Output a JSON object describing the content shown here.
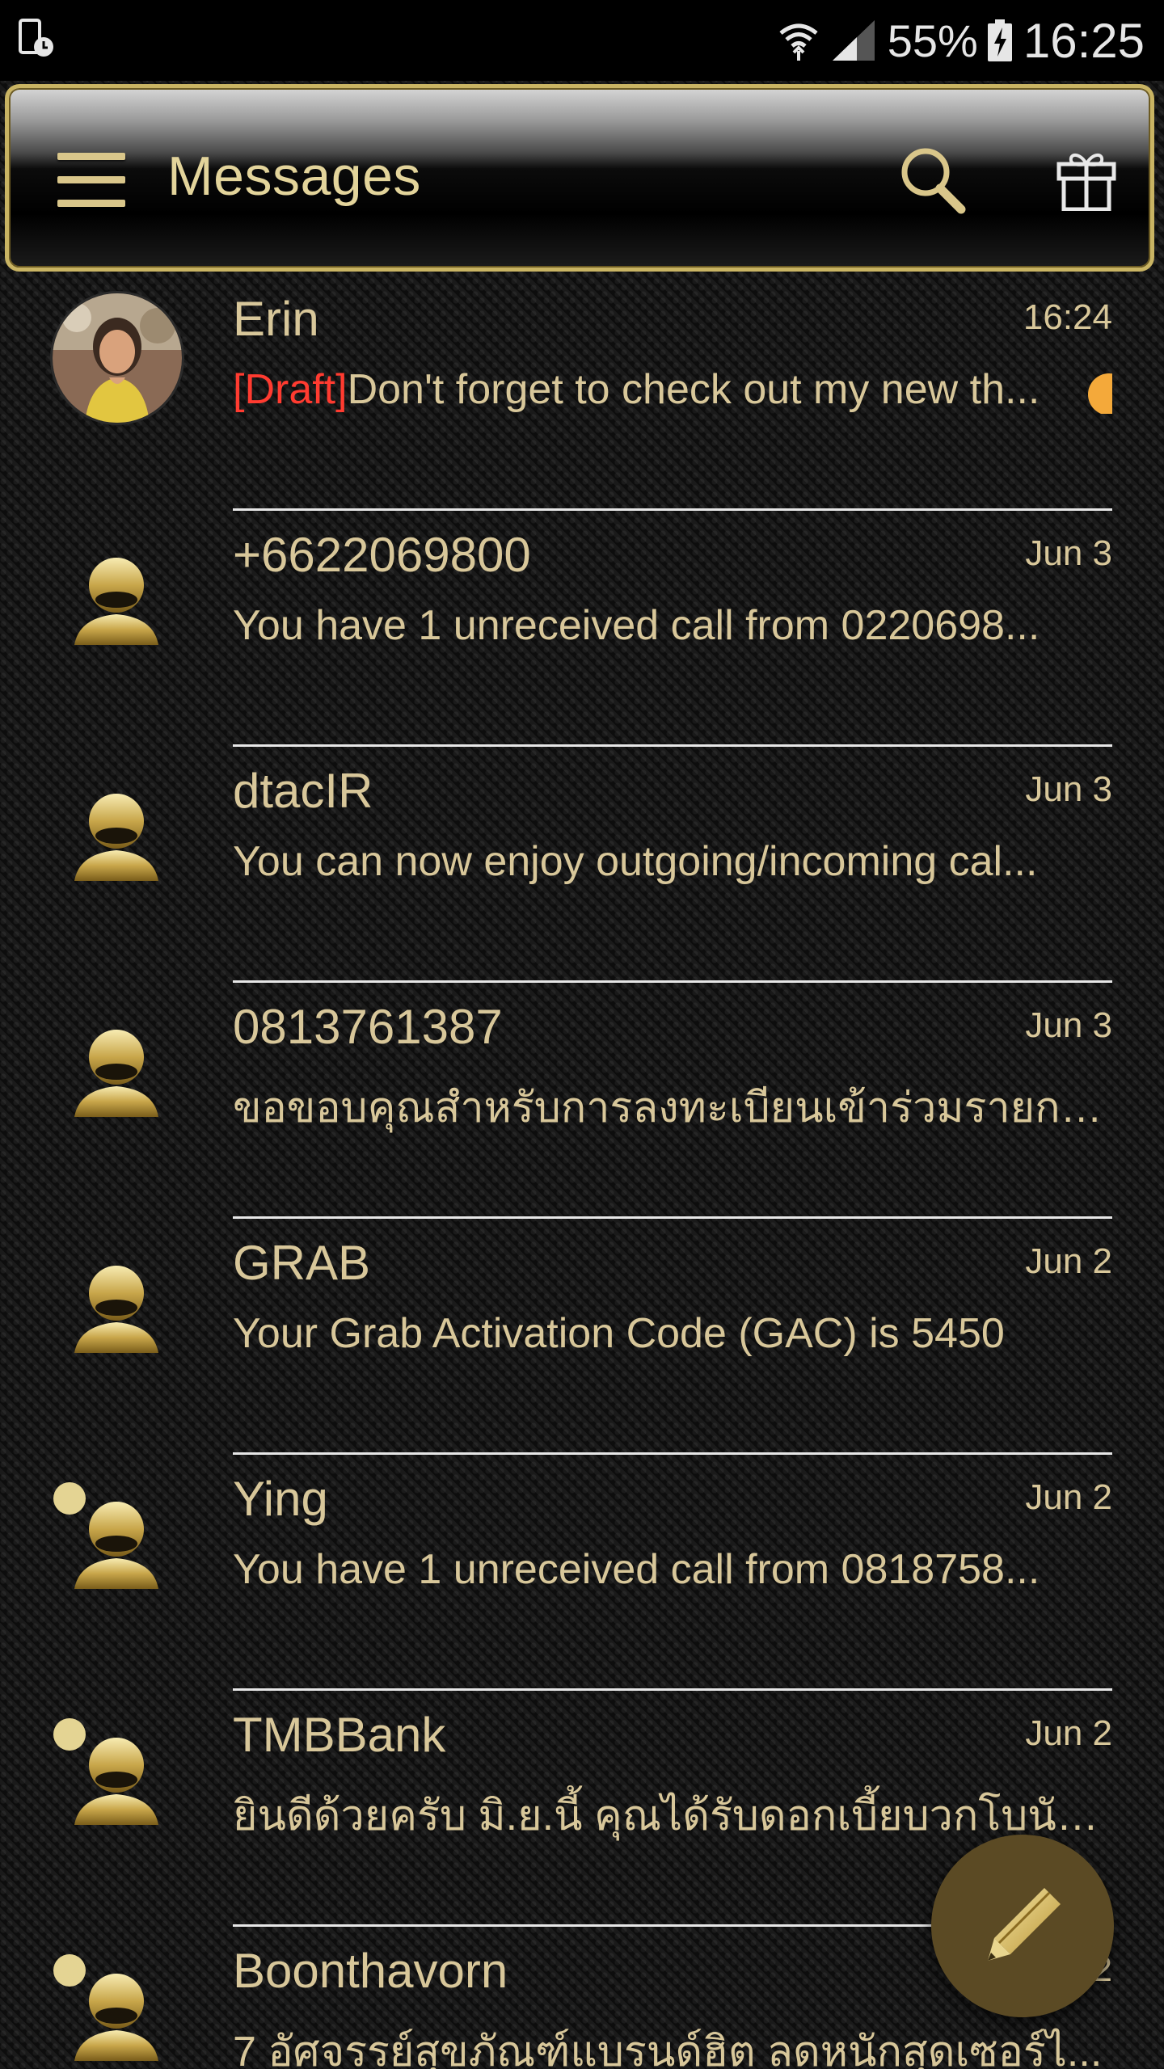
{
  "status_bar": {
    "battery_percent": "55%",
    "time": "16:25"
  },
  "header": {
    "title": "Messages"
  },
  "conversations": [
    {
      "name": "Erin",
      "date": "16:24",
      "draft_tag": "[Draft]",
      "preview": "Don't forget to check out my new th...",
      "avatar": "photo",
      "unread": false
    },
    {
      "name": "+6622069800",
      "date": "Jun 3",
      "preview": "You have 1 unreceived call from 0220698...",
      "avatar": "default",
      "unread": false
    },
    {
      "name": "dtacIR",
      "date": "Jun 3",
      "preview": "You can now enjoy outgoing/incoming cal...",
      "avatar": "default",
      "unread": false
    },
    {
      "name": "0813761387",
      "date": "Jun 3",
      "preview": "ขอขอบคุณสำหรับการลงทะเบียนเข้าร่วมรายกา...",
      "avatar": "default",
      "unread": false
    },
    {
      "name": "GRAB",
      "date": "Jun 2",
      "preview": "Your Grab Activation Code (GAC) is 5450",
      "avatar": "default",
      "unread": false
    },
    {
      "name": "Ying",
      "date": "Jun 2",
      "preview": "You have 1 unreceived call from 0818758...",
      "avatar": "default",
      "unread": true
    },
    {
      "name": "TMBBank",
      "date": "Jun 2",
      "preview": "ยินดีด้วยครับ มิ.ย.นี้ คุณได้รับดอกเบี้ยบวกโบนัส...",
      "avatar": "default",
      "unread": true
    },
    {
      "name": "Boonthavorn",
      "date": "2",
      "preview": "7 อัศจรรย์สุขภัณฑ์แบรนด์ฮิต ลดหนักสุดเซอร์ไ...",
      "avatar": "default",
      "unread": true
    }
  ],
  "icons": {
    "menu": "hamburger-icon",
    "search": "search-icon",
    "gift": "gift-icon",
    "compose": "pencil-icon",
    "contact": "person-icon"
  },
  "colors": {
    "accent_gold": "#d8c79a",
    "draft_red": "#ff3b30",
    "fab": "#5b4a24"
  }
}
